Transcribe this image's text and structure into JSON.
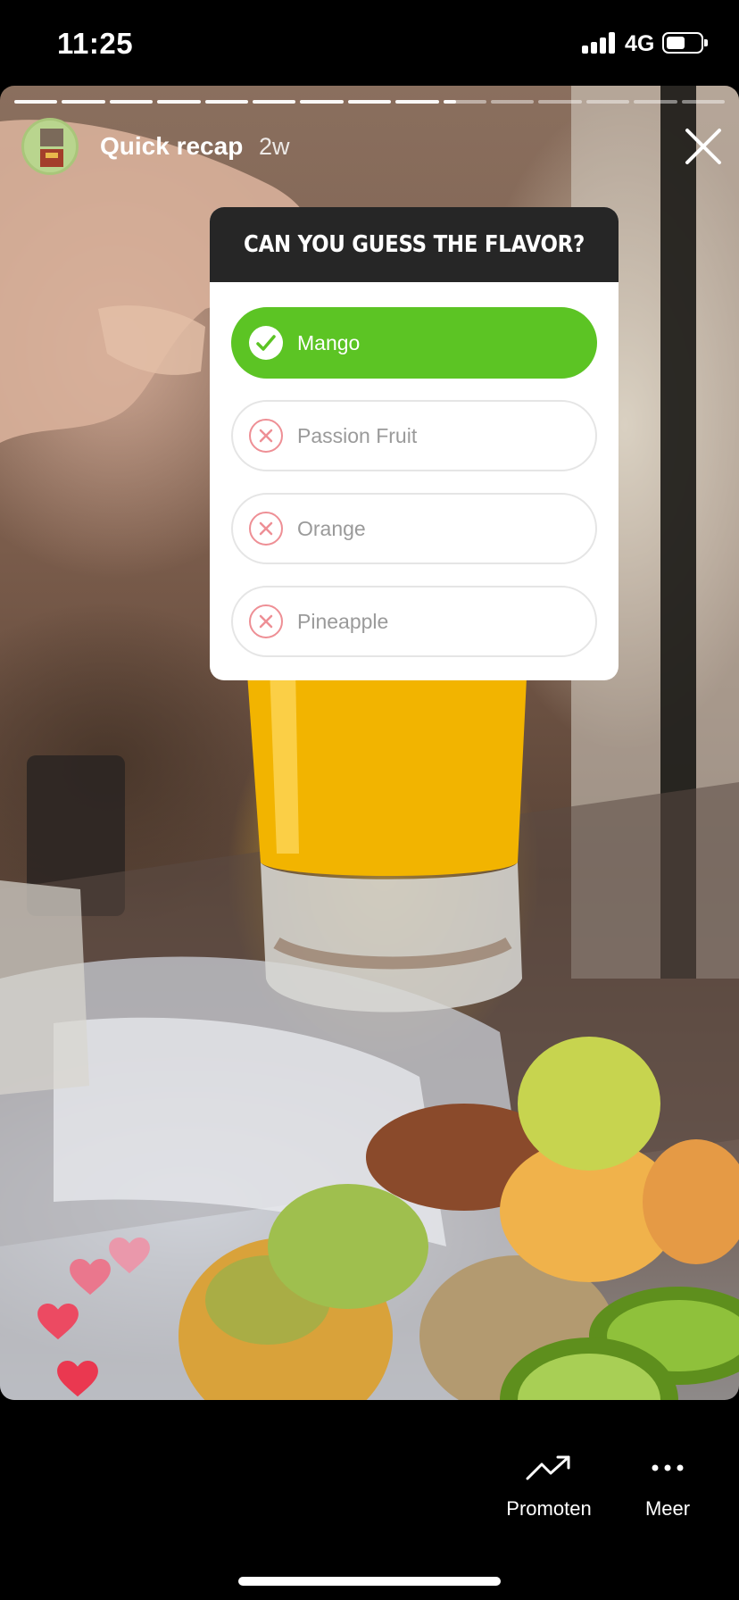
{
  "status_bar": {
    "time": "11:25",
    "network": "4G"
  },
  "story": {
    "progress": {
      "total_segments": 15,
      "completed_segments": 9,
      "current_segment_fraction": 0.3
    },
    "account_name": "Quick recap",
    "age": "2w",
    "quiz": {
      "question": "CAN YOU GUESS THE FLAVOR?",
      "options": [
        {
          "label": "Mango",
          "state": "correct",
          "icon": "check-icon"
        },
        {
          "label": "Passion Fruit",
          "state": "incorrect",
          "icon": "x-circle-icon"
        },
        {
          "label": "Orange",
          "state": "incorrect",
          "icon": "x-circle-icon"
        },
        {
          "label": "Pineapple",
          "state": "incorrect",
          "icon": "x-circle-icon"
        }
      ],
      "colors": {
        "correct": "#5cc424",
        "header": "#262626",
        "incorrect_icon": "#ee8f95"
      }
    },
    "reaction_icons": [
      "heart-icon",
      "heart-icon",
      "heart-icon",
      "heart-icon"
    ]
  },
  "bottom_bar": {
    "promote_label": "Promoten",
    "promote_icon": "trending-up-icon",
    "more_label": "Meer",
    "more_icon": "more-icon"
  }
}
